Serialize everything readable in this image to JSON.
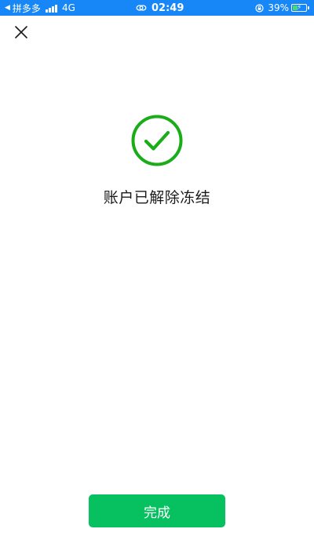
{
  "status_bar": {
    "back_glyph": "◀",
    "back_app": "拼多多",
    "network": "4G",
    "time": "02:49",
    "battery_percent_text": "39%",
    "battery_level": 0.39,
    "background_color": "#1787f7"
  },
  "header": {
    "close_icon": "close-icon"
  },
  "main": {
    "icon": "check-circle-icon",
    "icon_color": "#1aad19",
    "message": "账户已解除冻结"
  },
  "footer": {
    "done_label": "完成",
    "button_color": "#07c160"
  }
}
